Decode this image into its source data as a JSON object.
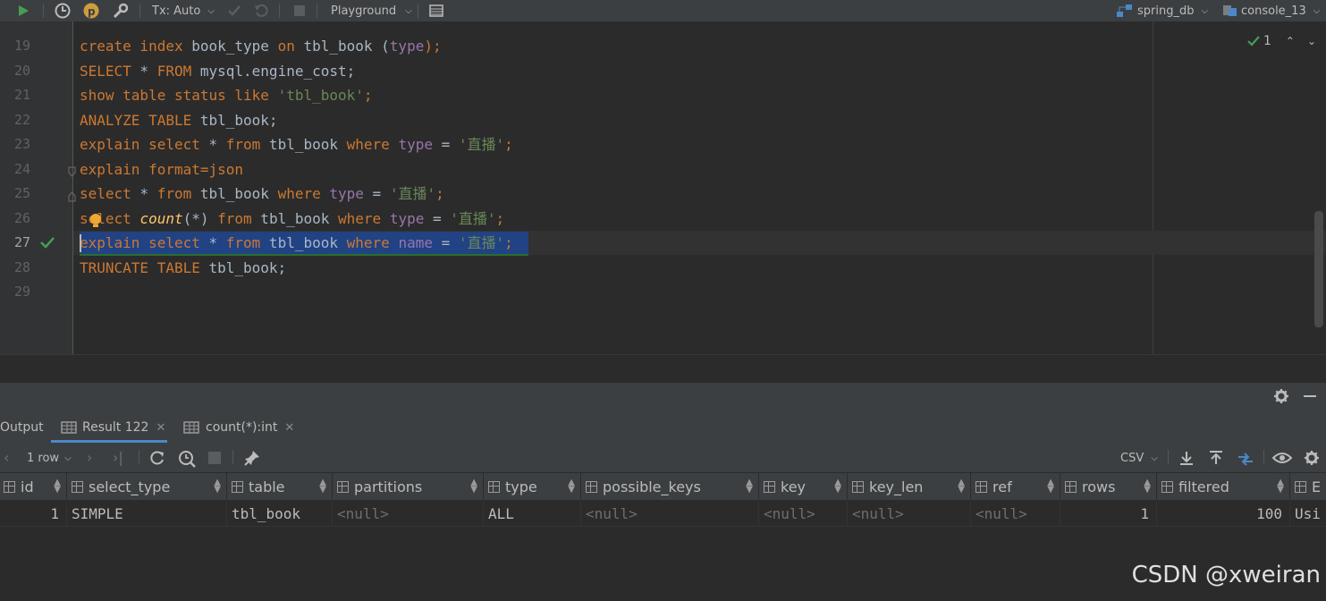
{
  "toolbar": {
    "tx_mode": "Tx: Auto",
    "playground": "Playground",
    "datasource": "spring_db",
    "console": "console_13"
  },
  "editor": {
    "inspection_count": "1",
    "lines": [
      {
        "num": "19"
      },
      {
        "num": "20"
      },
      {
        "num": "21"
      },
      {
        "num": "22"
      },
      {
        "num": "23"
      },
      {
        "num": "24"
      },
      {
        "num": "25"
      },
      {
        "num": "26"
      },
      {
        "num": "27"
      },
      {
        "num": "28"
      },
      {
        "num": "29"
      }
    ],
    "code": {
      "l19": [
        "create index",
        " book_type ",
        "on",
        " tbl_book (",
        "type",
        ");"
      ],
      "l20": [
        "SELECT",
        " * ",
        "FROM",
        " mysql.engine_cost;"
      ],
      "l21": [
        "show table status like",
        " ",
        "'tbl_book'",
        ";"
      ],
      "l22": [
        "ANALYZE TABLE",
        " tbl_book;"
      ],
      "l23": [
        "explain select",
        " * ",
        "from",
        " tbl_book ",
        "where",
        " ",
        "type",
        " = ",
        "'直播'",
        ";"
      ],
      "l24": [
        "explain format",
        "=json"
      ],
      "l25": [
        "select",
        " * ",
        "from",
        " tbl_book ",
        "where",
        " ",
        "type",
        " = ",
        "'直播'",
        ";"
      ],
      "l26": [
        "select",
        " ",
        "count",
        "(*) ",
        "from",
        " tbl_book ",
        "where",
        " ",
        "type",
        " = ",
        "'直播'",
        ";"
      ],
      "l27": [
        "explain select",
        " * ",
        "from",
        " tbl_book ",
        "where",
        " ",
        "name",
        " = ",
        "'直播'",
        ";"
      ],
      "l28": [
        "TRUNCATE TABLE",
        " tbl_book;"
      ]
    }
  },
  "results": {
    "tabs": [
      "Output",
      "Result 122",
      "count(*):int"
    ],
    "row_count": "1 row",
    "export_format": "CSV",
    "columns": [
      "id",
      "select_type",
      "table",
      "partitions",
      "type",
      "possible_keys",
      "key",
      "key_len",
      "ref",
      "rows",
      "filtered",
      "E"
    ],
    "row": [
      "1",
      "SIMPLE",
      "tbl_book",
      "<null>",
      "ALL",
      "<null>",
      "<null>",
      "<null>",
      "<null>",
      "1",
      "100",
      "Usi"
    ]
  },
  "watermark": "CSDN @xweiran",
  "colors": {
    "keyword": "#cc7832",
    "string": "#6a8759",
    "column": "#9876aa",
    "function": "#ffc66d",
    "selection": "#214283",
    "run": "#499c54"
  }
}
